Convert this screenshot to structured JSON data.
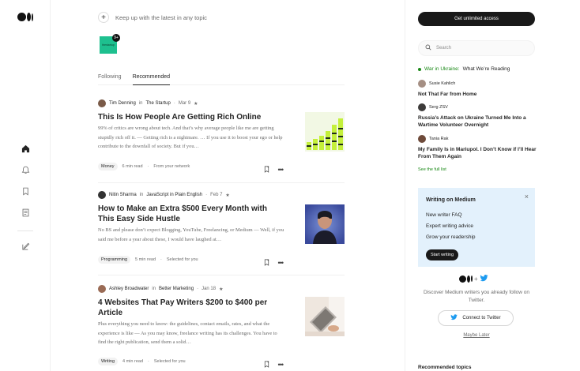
{
  "rail": {
    "icons": [
      "medium-logo",
      "home-icon",
      "bell-icon",
      "bookmark-icon",
      "stories-icon",
      "write-icon"
    ]
  },
  "main": {
    "topic_prompt": "Keep up with the latest in any topic",
    "pub_thumb_text": "thestartup",
    "pub_badge": "9+",
    "tabs": [
      {
        "label": "Following",
        "active": false
      },
      {
        "label": "Recommended",
        "active": true
      }
    ],
    "articles": [
      {
        "author": "Tim Denning",
        "in_word": "in",
        "publication": "The Startup",
        "date": "Mar 9",
        "title": "This Is How People Are Getting Rich Online",
        "snippet": "99% of critics are wrong about tech. And that’s why average people like me are getting stupidly rich off it. — Getting rich is a nightmare. … If you use it to boost your ego or help contribute to the downfall of society. But if you…",
        "tag": "Money",
        "read_time": "6 min read",
        "reason": "From your network"
      },
      {
        "author": "Nitin Sharma",
        "in_word": "in",
        "publication": "JavaScript in Plain English",
        "date": "Feb 7",
        "title": "How to Make an Extra $500 Every Month with This Easy Side Hustle",
        "snippet": "No BS and please don’t expect Blogging, YouTube, Freelancing, or Medium — Well, if you said me before a year about these, I would have laughed at…",
        "tag": "Programming",
        "read_time": "5 min read",
        "reason": "Selected for you"
      },
      {
        "author": "Ashley Broadwater",
        "in_word": "in",
        "publication": "Better Marketing",
        "date": "Jan 18",
        "title": "4 Websites That Pay Writers $200 to $400 per Article",
        "snippet": "Plus everything you need to know: the guidelines, contact emails, rates, and what the experience is like — As you may know, freelance writing has its challenges. You have to find the right publication, send them a solid…",
        "tag": "Writing",
        "read_time": "4 min read",
        "reason": "Selected for you"
      }
    ]
  },
  "side": {
    "cta": "Get unlimited access",
    "search_placeholder": "Search",
    "news_label_green": "War in Ukraine:",
    "news_label_rest": "What We’re Reading",
    "news": [
      {
        "author": "Susie Kahlich",
        "title": "Not That Far from Home"
      },
      {
        "author": "Serg ZSV",
        "title": "Russia’s Attack on Ukraine Turned Me Into a Wartime Volunteer Overnight"
      },
      {
        "author": "Tania Rak",
        "title": "My Family Is in Mariupol. I Don’t Know if I’ll Hear From Them Again"
      }
    ],
    "full_list": "See the full list",
    "writing_card": {
      "title": "Writing on Medium",
      "close": "×",
      "items": [
        "New writer FAQ",
        "Expert writing advice",
        "Grow your readership"
      ],
      "button": "Start writing"
    },
    "twitter": {
      "plus": "+",
      "text": "Discover Medium writers you already follow on Twitter.",
      "button": "Connect to Twitter",
      "later": "Maybe Later"
    },
    "recommended_topics": "Recommended topics"
  },
  "colors": {
    "accent_green": "#1a8917",
    "card_bg": "#e3f1fc",
    "twitter_blue": "#1d9bf0"
  }
}
